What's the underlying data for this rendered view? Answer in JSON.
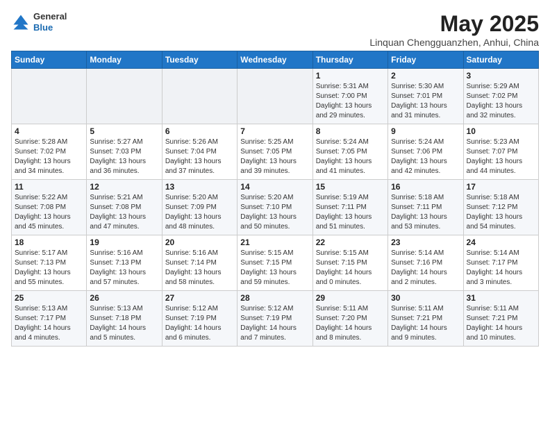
{
  "header": {
    "logo": {
      "general": "General",
      "blue": "Blue"
    },
    "title": "May 2025",
    "subtitle": "Linquan Chengguanzhen, Anhui, China"
  },
  "weekdays": [
    "Sunday",
    "Monday",
    "Tuesday",
    "Wednesday",
    "Thursday",
    "Friday",
    "Saturday"
  ],
  "weeks": [
    [
      {
        "day": "",
        "info": ""
      },
      {
        "day": "",
        "info": ""
      },
      {
        "day": "",
        "info": ""
      },
      {
        "day": "",
        "info": ""
      },
      {
        "day": "1",
        "info": "Sunrise: 5:31 AM\nSunset: 7:00 PM\nDaylight: 13 hours\nand 29 minutes."
      },
      {
        "day": "2",
        "info": "Sunrise: 5:30 AM\nSunset: 7:01 PM\nDaylight: 13 hours\nand 31 minutes."
      },
      {
        "day": "3",
        "info": "Sunrise: 5:29 AM\nSunset: 7:02 PM\nDaylight: 13 hours\nand 32 minutes."
      }
    ],
    [
      {
        "day": "4",
        "info": "Sunrise: 5:28 AM\nSunset: 7:02 PM\nDaylight: 13 hours\nand 34 minutes."
      },
      {
        "day": "5",
        "info": "Sunrise: 5:27 AM\nSunset: 7:03 PM\nDaylight: 13 hours\nand 36 minutes."
      },
      {
        "day": "6",
        "info": "Sunrise: 5:26 AM\nSunset: 7:04 PM\nDaylight: 13 hours\nand 37 minutes."
      },
      {
        "day": "7",
        "info": "Sunrise: 5:25 AM\nSunset: 7:05 PM\nDaylight: 13 hours\nand 39 minutes."
      },
      {
        "day": "8",
        "info": "Sunrise: 5:24 AM\nSunset: 7:05 PM\nDaylight: 13 hours\nand 41 minutes."
      },
      {
        "day": "9",
        "info": "Sunrise: 5:24 AM\nSunset: 7:06 PM\nDaylight: 13 hours\nand 42 minutes."
      },
      {
        "day": "10",
        "info": "Sunrise: 5:23 AM\nSunset: 7:07 PM\nDaylight: 13 hours\nand 44 minutes."
      }
    ],
    [
      {
        "day": "11",
        "info": "Sunrise: 5:22 AM\nSunset: 7:08 PM\nDaylight: 13 hours\nand 45 minutes."
      },
      {
        "day": "12",
        "info": "Sunrise: 5:21 AM\nSunset: 7:08 PM\nDaylight: 13 hours\nand 47 minutes."
      },
      {
        "day": "13",
        "info": "Sunrise: 5:20 AM\nSunset: 7:09 PM\nDaylight: 13 hours\nand 48 minutes."
      },
      {
        "day": "14",
        "info": "Sunrise: 5:20 AM\nSunset: 7:10 PM\nDaylight: 13 hours\nand 50 minutes."
      },
      {
        "day": "15",
        "info": "Sunrise: 5:19 AM\nSunset: 7:11 PM\nDaylight: 13 hours\nand 51 minutes."
      },
      {
        "day": "16",
        "info": "Sunrise: 5:18 AM\nSunset: 7:11 PM\nDaylight: 13 hours\nand 53 minutes."
      },
      {
        "day": "17",
        "info": "Sunrise: 5:18 AM\nSunset: 7:12 PM\nDaylight: 13 hours\nand 54 minutes."
      }
    ],
    [
      {
        "day": "18",
        "info": "Sunrise: 5:17 AM\nSunset: 7:13 PM\nDaylight: 13 hours\nand 55 minutes."
      },
      {
        "day": "19",
        "info": "Sunrise: 5:16 AM\nSunset: 7:13 PM\nDaylight: 13 hours\nand 57 minutes."
      },
      {
        "day": "20",
        "info": "Sunrise: 5:16 AM\nSunset: 7:14 PM\nDaylight: 13 hours\nand 58 minutes."
      },
      {
        "day": "21",
        "info": "Sunrise: 5:15 AM\nSunset: 7:15 PM\nDaylight: 13 hours\nand 59 minutes."
      },
      {
        "day": "22",
        "info": "Sunrise: 5:15 AM\nSunset: 7:15 PM\nDaylight: 14 hours\nand 0 minutes."
      },
      {
        "day": "23",
        "info": "Sunrise: 5:14 AM\nSunset: 7:16 PM\nDaylight: 14 hours\nand 2 minutes."
      },
      {
        "day": "24",
        "info": "Sunrise: 5:14 AM\nSunset: 7:17 PM\nDaylight: 14 hours\nand 3 minutes."
      }
    ],
    [
      {
        "day": "25",
        "info": "Sunrise: 5:13 AM\nSunset: 7:17 PM\nDaylight: 14 hours\nand 4 minutes."
      },
      {
        "day": "26",
        "info": "Sunrise: 5:13 AM\nSunset: 7:18 PM\nDaylight: 14 hours\nand 5 minutes."
      },
      {
        "day": "27",
        "info": "Sunrise: 5:12 AM\nSunset: 7:19 PM\nDaylight: 14 hours\nand 6 minutes."
      },
      {
        "day": "28",
        "info": "Sunrise: 5:12 AM\nSunset: 7:19 PM\nDaylight: 14 hours\nand 7 minutes."
      },
      {
        "day": "29",
        "info": "Sunrise: 5:11 AM\nSunset: 7:20 PM\nDaylight: 14 hours\nand 8 minutes."
      },
      {
        "day": "30",
        "info": "Sunrise: 5:11 AM\nSunset: 7:21 PM\nDaylight: 14 hours\nand 9 minutes."
      },
      {
        "day": "31",
        "info": "Sunrise: 5:11 AM\nSunset: 7:21 PM\nDaylight: 14 hours\nand 10 minutes."
      }
    ]
  ]
}
